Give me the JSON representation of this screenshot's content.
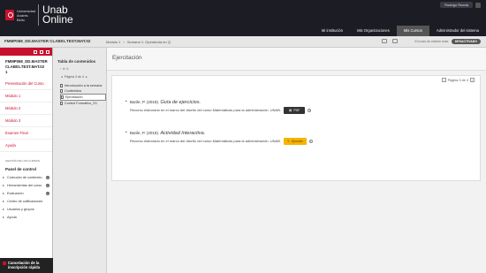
{
  "header": {
    "logo_small": "Universidad Andrés Bello",
    "logo_line1": "Unab",
    "logo_line2": "Online",
    "user_name": "Rodrigo Rueda",
    "nav": [
      {
        "label": "Mi institución"
      },
      {
        "label": "Mis Organizaciones"
      },
      {
        "label": "Mis Cursos",
        "active": true
      },
      {
        "label": "Administrador del sistema"
      }
    ]
  },
  "crumbbar": {
    "course_id": "FMMP068_DD.MASTER CLAB01.TEST.MAT.02",
    "crumbs": [
      "Módulo 1",
      "Semana 1: Operatoria en Q"
    ],
    "edit_mode_label": "El modo de edición está:",
    "edit_mode_value": "DESACTIVADO"
  },
  "sidebar": {
    "course_title": "FMMP068_DD.MASTER CLAB01.TEST.MAT.02 1",
    "items": [
      {
        "label": "Presentación del Curso"
      },
      {
        "label": "Módulo 1"
      },
      {
        "label": "Módulo 2"
      },
      {
        "label": "Módulo 3"
      },
      {
        "label": "Examen Final"
      },
      {
        "label": "Ayuda"
      }
    ],
    "section_label": "GESTIÓN DE LOS CURSOS",
    "panel_title": "Panel de control",
    "panel_items": [
      {
        "label": "Colección de contenido"
      },
      {
        "label": "Herramientas del curso"
      },
      {
        "label": "Evaluación"
      },
      {
        "label": "Centro de calificaciones"
      },
      {
        "label": "Usuarios y grupos"
      },
      {
        "label": "Ayuda"
      }
    ],
    "cancel_label": "Cancelación de la inscripción rápida"
  },
  "toc": {
    "title": "Tabla de contenidos",
    "controls": "↕ ⊕ ⊖",
    "page_label": "Página 3 de 4",
    "items": [
      {
        "label": "Introducción a la semana"
      },
      {
        "label": "Contenidos"
      },
      {
        "label": "Ejercitación",
        "active": true
      },
      {
        "label": "Control Formativo_S1"
      }
    ]
  },
  "main": {
    "title": "Ejercitación",
    "page_label": "Página 3 de 4",
    "entries": [
      {
        "author": "Barile, P. (2019).",
        "title": "Guía de ejercicios.",
        "desc": "Recurso elaborado en el marco del diseño del curso Matemáticas para la administración, UNAB.",
        "button": "PDF"
      },
      {
        "author": "Barile, P. (2019).",
        "title": "Actividad Interactiva.",
        "desc": "Recurso elaborado en el marco del diseño del curso Matemáticas para la administración, UNAB.",
        "button": "Ejercitar"
      }
    ]
  },
  "colors": {
    "brand_red": "#c8102e",
    "header_bg": "#1c1c24",
    "activity_yellow": "#f4b400"
  }
}
